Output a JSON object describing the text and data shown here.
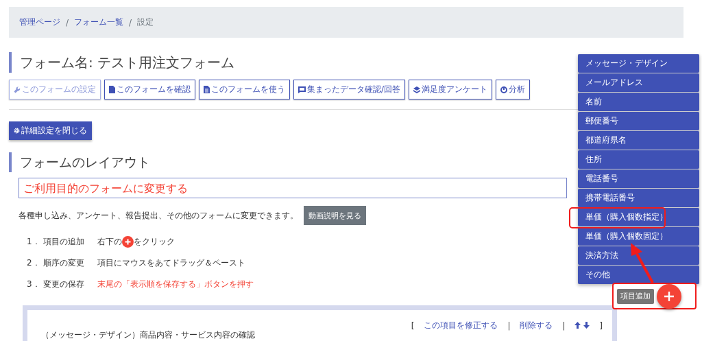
{
  "breadcrumb": {
    "separator": "/",
    "items": [
      {
        "label": "管理ページ",
        "link": true
      },
      {
        "label": "フォーム一覧",
        "link": true
      },
      {
        "label": "設定",
        "link": false
      }
    ]
  },
  "form_title": "フォーム名: テスト用注文フォーム",
  "tabs": [
    {
      "label": "このフォームの設定",
      "selected": true
    },
    {
      "label": "このフォームを確認",
      "selected": false
    },
    {
      "label": "このフォームを使う",
      "selected": false
    },
    {
      "label": "集まったデータ確認/回答",
      "selected": false
    },
    {
      "label": "満足度アンケート",
      "selected": false
    },
    {
      "label": "分析",
      "selected": false
    }
  ],
  "toggle_button": "詳細設定を閉じる",
  "layout_heading": "フォームのレイアウト",
  "purpose_link": "ご利用目的のフォームに変更する",
  "description": "各種申し込み、アンケート、報告提出、その他のフォームに変更できます。",
  "video_button": "動画説明を見る",
  "steps": [
    {
      "number": "1．",
      "label": "項目の追加",
      "kind": "plus",
      "before": "右下の",
      "after": "をクリック"
    },
    {
      "number": "2．",
      "label": "順序の変更",
      "kind": "text",
      "text": "項目にマウスをあてドラッグ＆ペースト"
    },
    {
      "number": "3．",
      "label": "変更の保存",
      "kind": "warning",
      "text": "末尾の「表示順を保存する」ボタンを押す"
    }
  ],
  "item_card": {
    "open": "[",
    "close": "]",
    "separator": "|",
    "actions": [
      "この項目を修正する",
      "削除する"
    ],
    "title": "（メッセージ・デザイン）商品内容・サービス内容の確認"
  },
  "add_menu": {
    "tooltip": "項目追加",
    "items": [
      {
        "label": "メッセージ・デザイン",
        "highlighted": false
      },
      {
        "label": "メールアドレス",
        "highlighted": false
      },
      {
        "label": "名前",
        "highlighted": false
      },
      {
        "label": "郵便番号",
        "highlighted": false
      },
      {
        "label": "都道府県名",
        "highlighted": false
      },
      {
        "label": "住所",
        "highlighted": false
      },
      {
        "label": "電話番号",
        "highlighted": false
      },
      {
        "label": "携帯電話番号",
        "highlighted": false
      },
      {
        "label": "単価（購入個数指定）",
        "highlighted": true
      },
      {
        "label": "単価（購入個数固定）",
        "highlighted": false
      },
      {
        "label": "決済方法",
        "highlighted": false
      },
      {
        "label": "その他",
        "highlighted": false
      }
    ]
  }
}
